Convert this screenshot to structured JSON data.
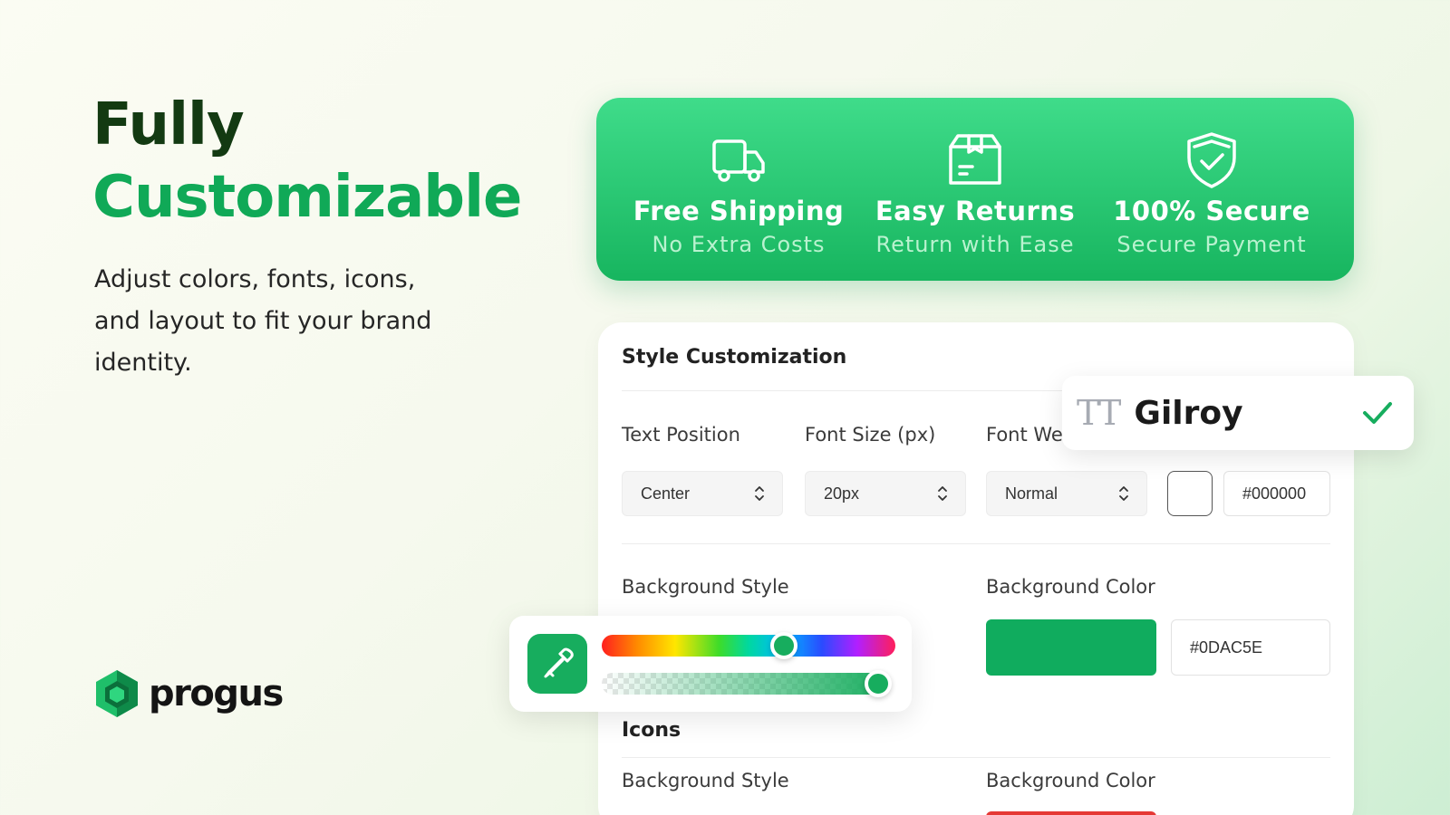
{
  "hero": {
    "title_line1": "Fully",
    "title_line2": "Customizable",
    "subtitle": "Adjust colors, fonts, icons, and layout to fit your brand identity."
  },
  "logo": {
    "text": "progus"
  },
  "banner": {
    "features": [
      {
        "icon": "truck-icon",
        "title": "Free Shipping",
        "subtitle": "No Extra Costs"
      },
      {
        "icon": "return-box-icon",
        "title": "Easy Returns",
        "subtitle": "Return with Ease"
      },
      {
        "icon": "shield-check-icon",
        "title": "100% Secure",
        "subtitle": "Secure Payment"
      }
    ]
  },
  "panel": {
    "title": "Style Customization",
    "text_position": {
      "label": "Text Position",
      "value": "Center"
    },
    "font_size": {
      "label": "Font Size (px)",
      "value": "20px"
    },
    "font_weight": {
      "label": "Font Weight",
      "value": "Normal"
    },
    "text_color": {
      "hex": "#000000"
    },
    "background_style": {
      "label": "Background Style"
    },
    "background_color": {
      "label": "Background Color",
      "hex": "#0DAC5E"
    },
    "icons_section": {
      "title": "Icons",
      "background_style_label": "Background Style",
      "background_color_label": "Background Color",
      "color_preview": "#E53935"
    }
  },
  "font_popup": {
    "icon_text": "TT",
    "font_name": "Gilroy",
    "selected": true
  },
  "color_picker": {
    "hue_position": 0.62,
    "alpha_position": 0.96,
    "color": "#17AD5E"
  },
  "colors": {
    "brand_green": "#10A957",
    "dark_green": "#133A12",
    "banner_top": "#3FDC8A",
    "banner_bottom": "#17B55F"
  }
}
